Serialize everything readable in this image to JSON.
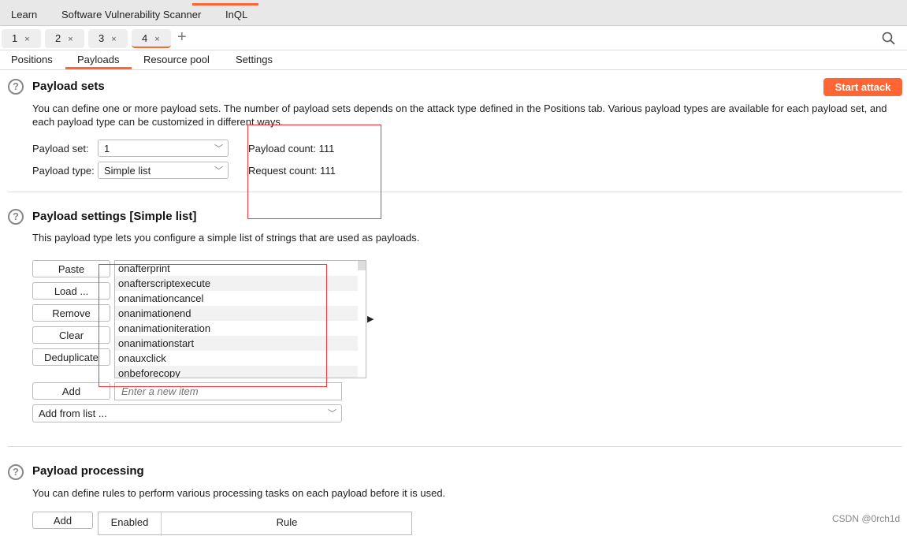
{
  "menu": [
    "Learn",
    "Software Vulnerability Scanner",
    "InQL"
  ],
  "tabs": [
    {
      "label": "1"
    },
    {
      "label": "2"
    },
    {
      "label": "3"
    },
    {
      "label": "4"
    }
  ],
  "tab_close": "×",
  "add_tab": "+",
  "subtabs": [
    "Positions",
    "Payloads",
    "Resource pool",
    "Settings"
  ],
  "payload_sets": {
    "title": "Payload sets",
    "desc": "You can define one or more payload sets. The number of payload sets depends on the attack type defined in the Positions tab. Various payload types are available for each payload set, and each payload type can be customized in different ways.",
    "set_label": "Payload set:",
    "set_value": "1",
    "type_label": "Payload type:",
    "type_value": "Simple list",
    "payload_count": "Payload count: 111",
    "request_count": "Request count: 111",
    "start": "Start attack"
  },
  "payload_settings": {
    "title": "Payload settings [Simple list]",
    "desc": "This payload type lets you configure a simple list of strings that are used as payloads.",
    "buttons": [
      "Paste",
      "Load ...",
      "Remove",
      "Clear",
      "Deduplicate"
    ],
    "items": [
      "onafterprint",
      "onafterscriptexecute",
      "onanimationcancel",
      "onanimationend",
      "onanimationiteration",
      "onanimationstart",
      "onauxclick",
      "onbeforecopy"
    ],
    "add": "Add",
    "add_placeholder": "Enter a new item",
    "add_from_list": "Add from list ..."
  },
  "payload_processing": {
    "title": "Payload processing",
    "desc": "You can define rules to perform various processing tasks on each payload before it is used.",
    "add": "Add",
    "columns": [
      "Enabled",
      "Rule"
    ]
  },
  "watermark": "CSDN @0rch1d",
  "colors": {
    "accent": "#ff6633",
    "annotation": "#ff3333"
  }
}
